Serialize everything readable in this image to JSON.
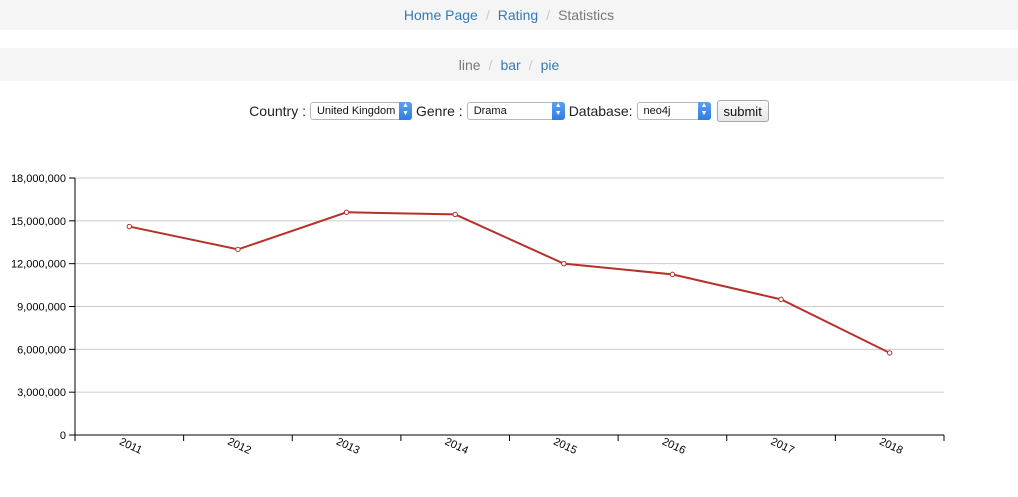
{
  "breadcrumb": {
    "home": "Home Page",
    "rating": "Rating",
    "statistics": "Statistics"
  },
  "chart_nav": {
    "line": "line",
    "bar": "bar",
    "pie": "pie"
  },
  "form": {
    "country_label": "Country :",
    "country_value": "United Kingdom",
    "genre_label": "Genre :",
    "genre_value": "Drama",
    "database_label": "Database:",
    "database_value": "neo4j",
    "submit_label": "submit"
  },
  "colors": {
    "line": "#b5312a",
    "link": "#337ab7",
    "grid": "#cccccc"
  },
  "chart_data": {
    "type": "line",
    "x": [
      "2011",
      "2012",
      "2013",
      "2014",
      "2015",
      "2016",
      "2017",
      "2018"
    ],
    "values": [
      14600000,
      13000000,
      15600000,
      15450000,
      12000000,
      11250000,
      9500000,
      5750000
    ],
    "ylim": [
      0,
      18000000
    ],
    "yticks": [
      0,
      3000000,
      6000000,
      9000000,
      12000000,
      15000000,
      18000000
    ],
    "grid": true,
    "title": "",
    "xlabel": "",
    "ylabel": ""
  }
}
